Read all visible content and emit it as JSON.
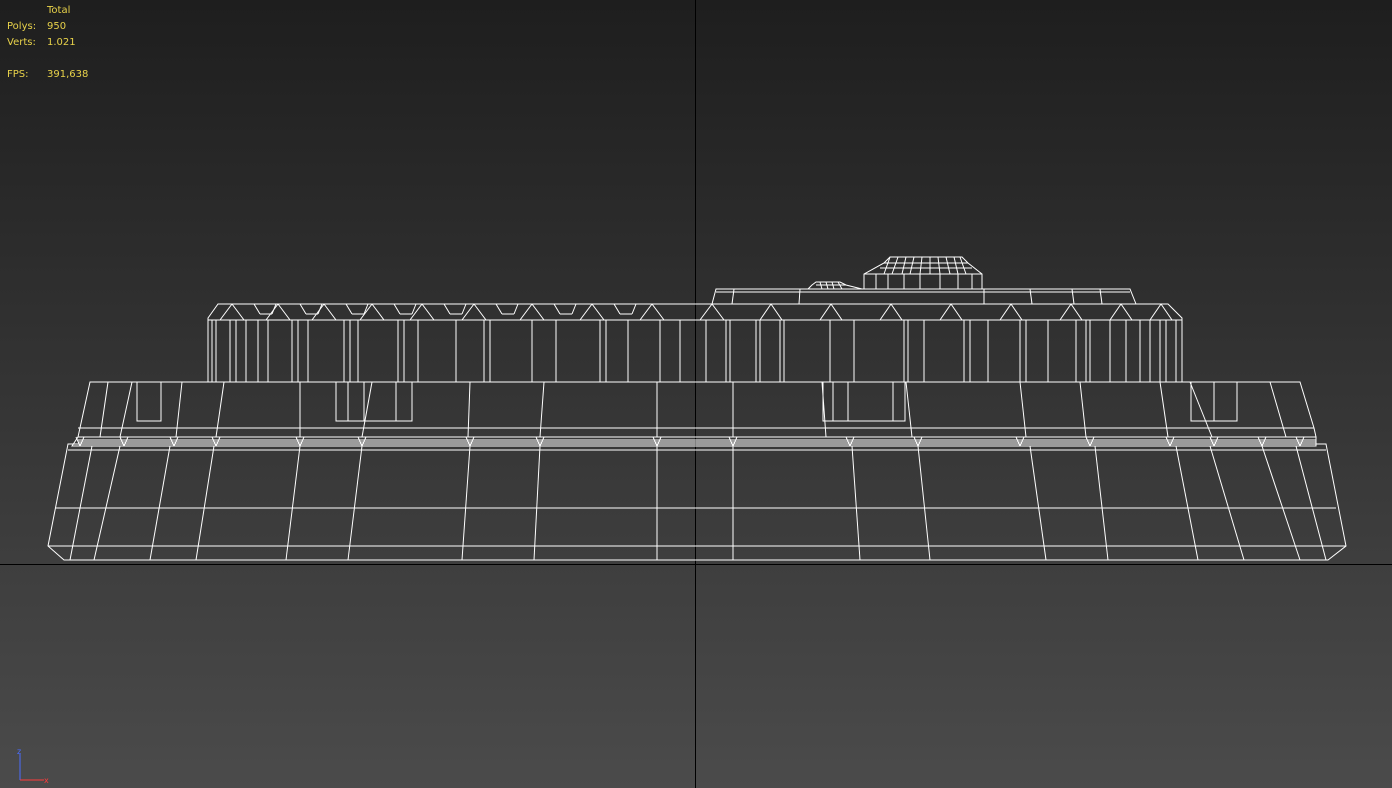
{
  "viewport": {
    "view": "front",
    "shading": "wireframe",
    "background_top": "#1e1e1e",
    "background_bottom": "#4a4a4a",
    "wire_color": "#ffffff",
    "grid_axis_color": "#000000"
  },
  "stats": {
    "header": "Total",
    "rows": [
      {
        "label": "Polys:",
        "value": "950"
      },
      {
        "label": "Verts:",
        "value": "1.021"
      }
    ],
    "fps": {
      "label": "FPS:",
      "value": "391,638"
    },
    "text_color": "#e8d24a"
  },
  "axis_gizmo": {
    "vertical_label": "z",
    "horizontal_label": "x",
    "vertical_color": "#4a6cff",
    "horizontal_color": "#ff3b3b"
  }
}
